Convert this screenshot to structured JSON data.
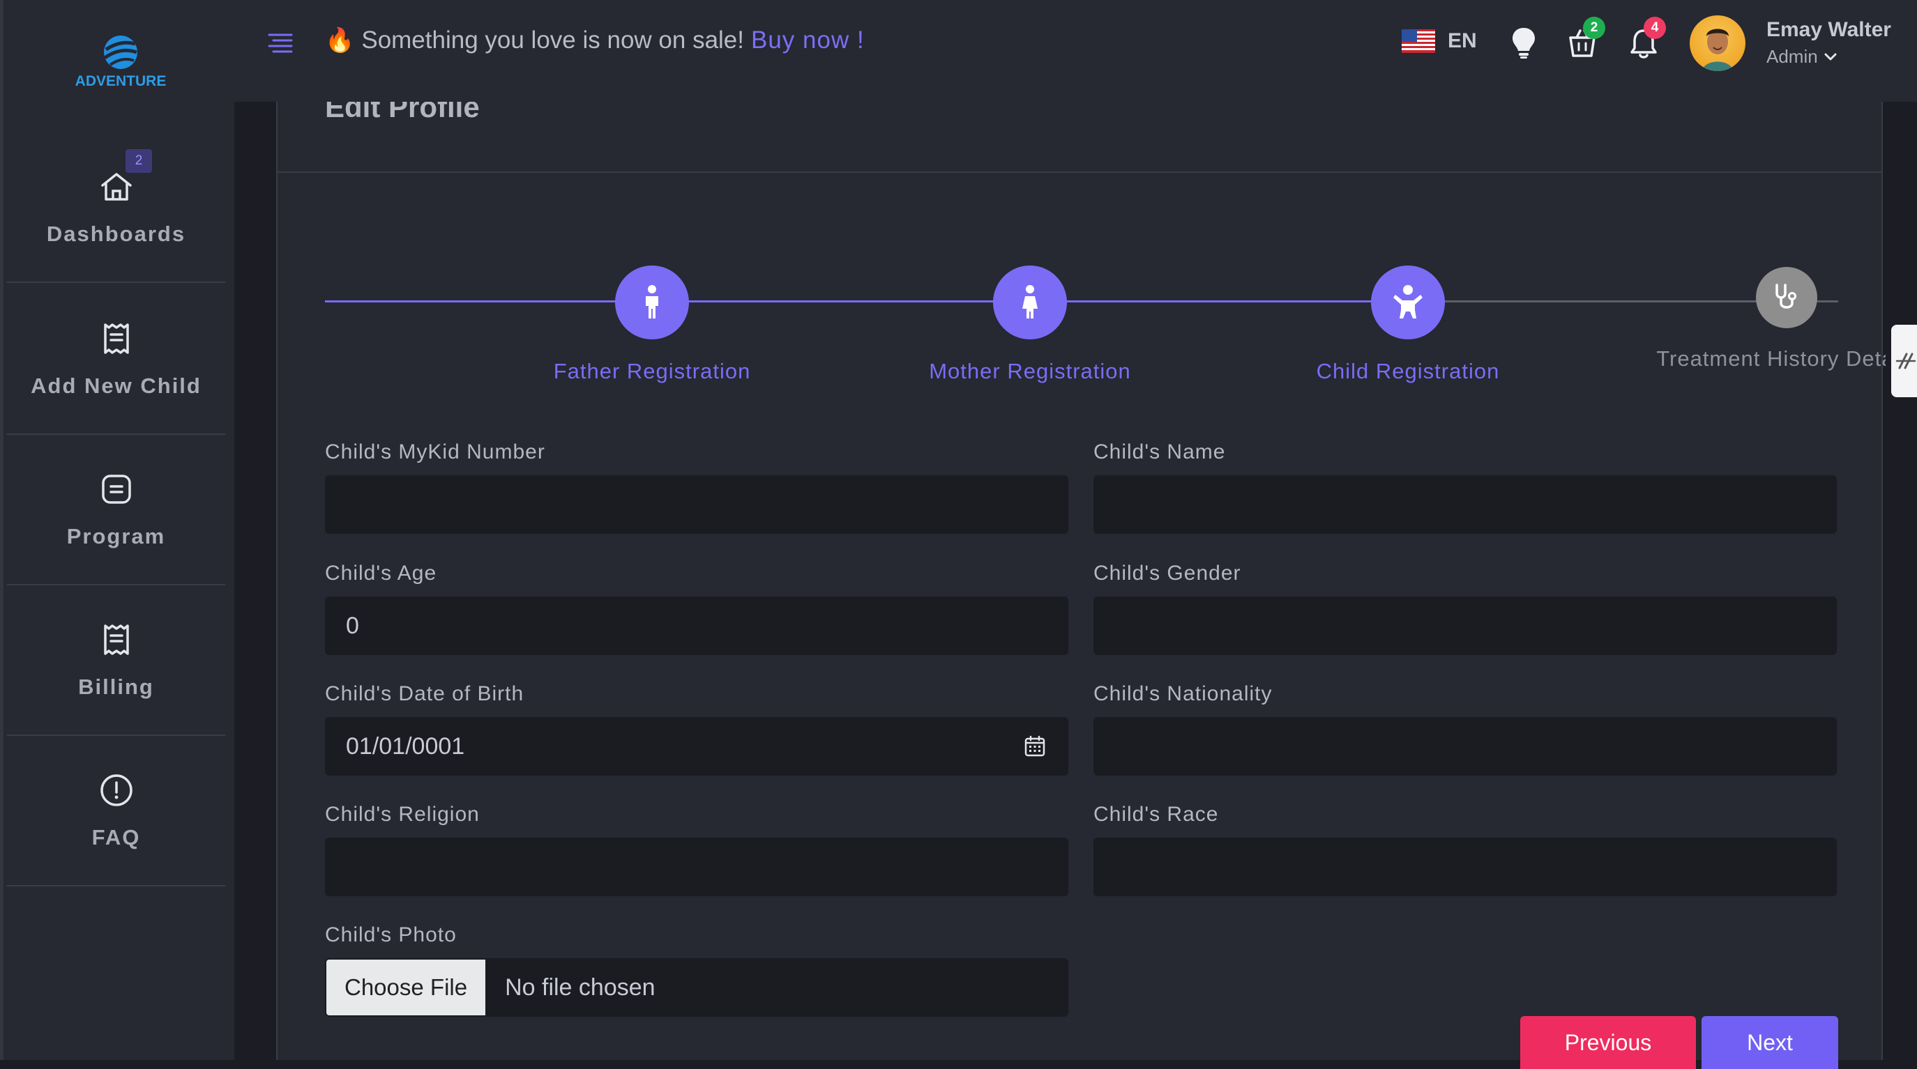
{
  "app": {
    "logo_text": "ADVENTURE"
  },
  "sidebar": {
    "items": [
      {
        "label": "Dashboards",
        "icon": "home-icon",
        "badge": "2"
      },
      {
        "label": "Add New Child",
        "icon": "receipt-icon"
      },
      {
        "label": "Program",
        "icon": "note-icon"
      },
      {
        "label": "Billing",
        "icon": "receipt-icon"
      },
      {
        "label": "FAQ",
        "icon": "alert-circle-icon"
      }
    ]
  },
  "header": {
    "promo_text": "Something you love is now on sale!",
    "promo_link": "Buy now !",
    "language": "EN",
    "cart_count": "2",
    "notification_count": "4",
    "user_name": "Emay Walter",
    "user_role": "Admin"
  },
  "card": {
    "title": "Edit Profile"
  },
  "stepper": {
    "steps": [
      {
        "label": "Father Registration",
        "icon": "person-icon",
        "state": "active"
      },
      {
        "label": "Mother Registration",
        "icon": "person-dress-icon",
        "state": "active"
      },
      {
        "label": "Child Registration",
        "icon": "child-icon",
        "state": "active"
      },
      {
        "label": "Treatment History Details",
        "icon": "stethoscope-icon",
        "state": "inactive"
      }
    ]
  },
  "form": {
    "mykid_label": "Child's MyKid Number",
    "mykid_value": "",
    "name_label": "Child's Name",
    "name_value": "",
    "age_label": "Child's Age",
    "age_value": "0",
    "gender_label": "Child's Gender",
    "gender_value": "",
    "dob_label": "Child's Date of Birth",
    "dob_value": "01/01/0001",
    "nationality_label": "Child's Nationality",
    "nationality_value": "",
    "religion_label": "Child's Religion",
    "religion_value": "",
    "race_label": "Child's Race",
    "race_value": "",
    "photo_label": "Child's Photo",
    "photo_button": "Choose File",
    "photo_status": "No file chosen"
  },
  "actions": {
    "previous": "Previous",
    "next": "Next"
  },
  "colors": {
    "accent": "#7b6cf6",
    "danger": "#ef2c5f",
    "success": "#1fae4f",
    "background": "#1c1d24",
    "panel": "#262832"
  }
}
